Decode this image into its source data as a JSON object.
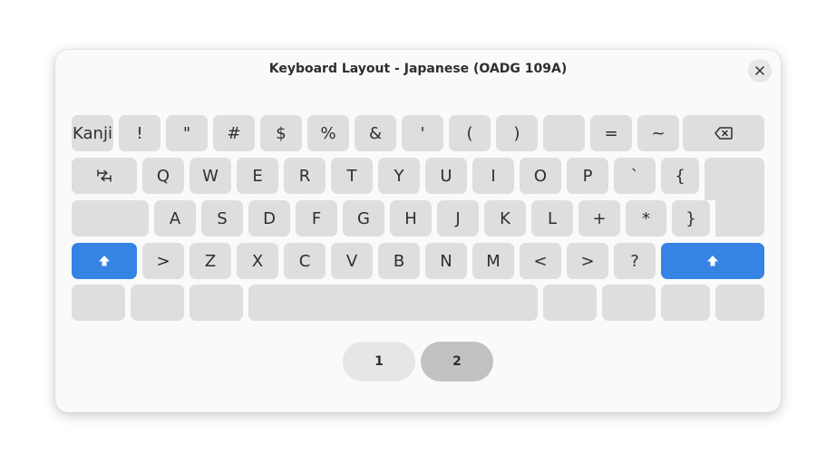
{
  "dialog": {
    "title": "Keyboard Layout - Japanese (OADG 109A)",
    "close_icon": "close-icon"
  },
  "keyboard": {
    "row1": [
      "Kanji",
      "!",
      "\"",
      "#",
      "$",
      "%",
      "&",
      "'",
      "(",
      ")",
      "",
      "=",
      "~"
    ],
    "backspace_icon": "backspace-icon",
    "tab_icon": "tab-icon",
    "row2": [
      "Q",
      "W",
      "E",
      "R",
      "T",
      "Y",
      "U",
      "I",
      "O",
      "P",
      "`",
      "{"
    ],
    "row3": [
      "A",
      "S",
      "D",
      "F",
      "G",
      "H",
      "J",
      "K",
      "L",
      "+",
      "*",
      "}"
    ],
    "shift_icon": "shift-icon",
    "row4": [
      ">",
      "Z",
      "X",
      "C",
      "V",
      "B",
      "N",
      "M",
      "<",
      ">",
      "?"
    ],
    "accent_color": "#3584e4"
  },
  "pages": {
    "items": [
      "1",
      "2"
    ],
    "selected": "2"
  }
}
